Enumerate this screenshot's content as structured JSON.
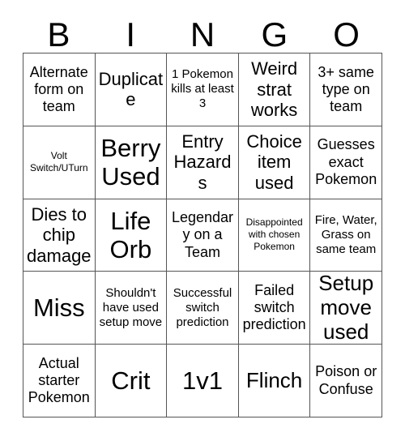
{
  "card": {
    "header_letters": [
      "B",
      "I",
      "N",
      "G",
      "O"
    ],
    "rows": [
      [
        {
          "text": "Alternate form on team",
          "size": "md"
        },
        {
          "text": "Duplicate",
          "size": "lg"
        },
        {
          "text": "1 Pokemon kills at least 3",
          "size": "sm"
        },
        {
          "text": "Weird strat works",
          "size": "lg"
        },
        {
          "text": "3+ same type on team",
          "size": "md"
        }
      ],
      [
        {
          "text": "Volt Switch/UTurn",
          "size": "xs"
        },
        {
          "text": "Berry Used",
          "size": "xxl"
        },
        {
          "text": "Entry Hazards",
          "size": "lg"
        },
        {
          "text": "Choice item used",
          "size": "lg"
        },
        {
          "text": "Guesses exact Pokemon",
          "size": "md"
        }
      ],
      [
        {
          "text": "Dies to chip damage",
          "size": "lg"
        },
        {
          "text": "Life Orb",
          "size": "xxl"
        },
        {
          "text": "Legendary on a Team",
          "size": "md"
        },
        {
          "text": "Disappointed with chosen Pokemon",
          "size": "xs"
        },
        {
          "text": "Fire, Water, Grass on same team",
          "size": "sm"
        }
      ],
      [
        {
          "text": "Miss",
          "size": "xxl"
        },
        {
          "text": "Shouldn't have used setup move",
          "size": "sm"
        },
        {
          "text": "Successful switch prediction",
          "size": "sm"
        },
        {
          "text": "Failed switch prediction",
          "size": "md"
        },
        {
          "text": "Setup move used",
          "size": "xl"
        }
      ],
      [
        {
          "text": "Actual starter Pokemon",
          "size": "md"
        },
        {
          "text": "Crit",
          "size": "xxl"
        },
        {
          "text": "1v1",
          "size": "xxl"
        },
        {
          "text": "Flinch",
          "size": "xl"
        },
        {
          "text": "Poison or Confuse",
          "size": "md"
        }
      ]
    ]
  }
}
